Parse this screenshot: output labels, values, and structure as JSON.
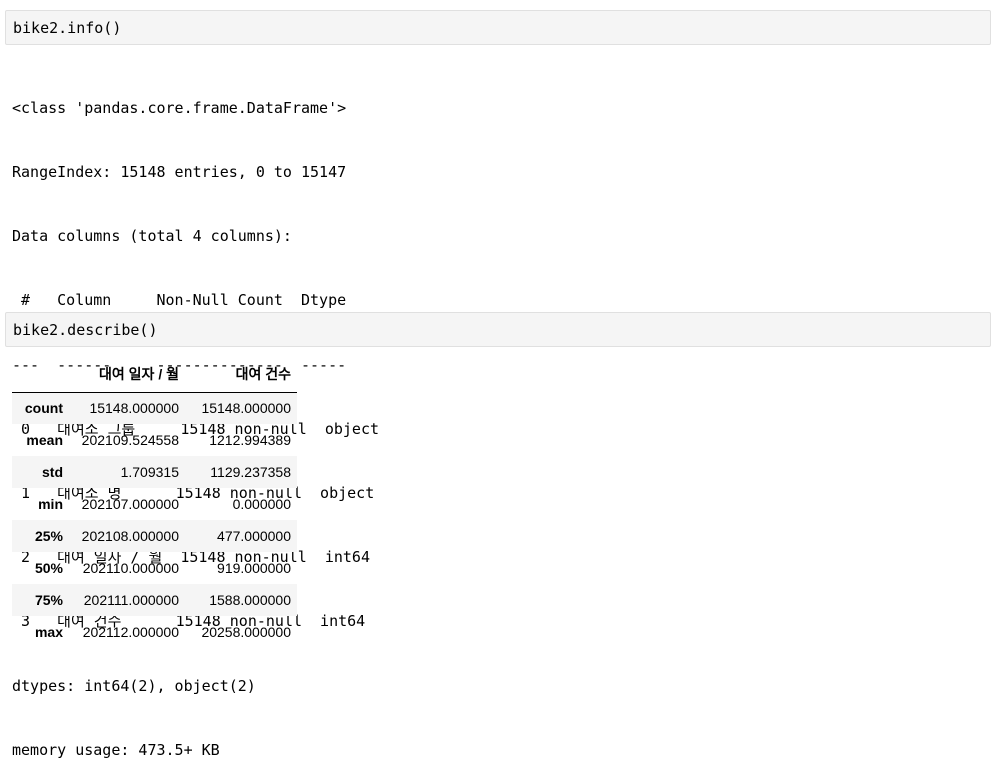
{
  "cells": [
    {
      "code": "bike2.info()",
      "output_lines": [
        "<class 'pandas.core.frame.DataFrame'>",
        "RangeIndex: 15148 entries, 0 to 15147",
        "Data columns (total 4 columns):",
        " #   Column     Non-Null Count  Dtype ",
        "---  ------     --------------  ----- ",
        " 0   대여소 그룹     15148 non-null  object",
        " 1   대여소 명      15148 non-null  object",
        " 2   대여 일자 / 월  15148 non-null  int64 ",
        " 3   대여 건수      15148 non-null  int64 ",
        "dtypes: int64(2), object(2)",
        "memory usage: 473.5+ KB"
      ]
    },
    {
      "code": "bike2.describe()",
      "table": {
        "columns": [
          "",
          "대여 일자 / 월",
          "대여 건수"
        ],
        "rows": [
          {
            "index": "count",
            "values": [
              "15148.000000",
              "15148.000000"
            ]
          },
          {
            "index": "mean",
            "values": [
              "202109.524558",
              "1212.994389"
            ]
          },
          {
            "index": "std",
            "values": [
              "1.709315",
              "1129.237358"
            ]
          },
          {
            "index": "min",
            "values": [
              "202107.000000",
              "0.000000"
            ]
          },
          {
            "index": "25%",
            "values": [
              "202108.000000",
              "477.000000"
            ]
          },
          {
            "index": "50%",
            "values": [
              "202110.000000",
              "919.000000"
            ]
          },
          {
            "index": "75%",
            "values": [
              "202111.000000",
              "1588.000000"
            ]
          },
          {
            "index": "max",
            "values": [
              "202112.000000",
              "20258.000000"
            ]
          }
        ]
      }
    }
  ],
  "colors": {
    "cell_background": "#f5f5f5",
    "cell_border": "#e0e0e0",
    "row_stripe": "#f5f5f5"
  }
}
